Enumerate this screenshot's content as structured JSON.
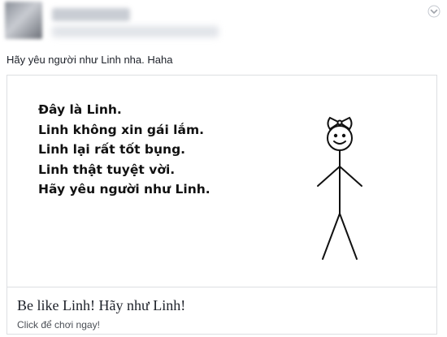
{
  "post": {
    "text": "Hãy yêu người như Linh nha. Haha"
  },
  "icons": {
    "options": "chevron-down-icon"
  },
  "card": {
    "image_lines": [
      "Đây là Linh.",
      "Linh không xin gái lắm.",
      "Linh lại rất tốt bụng.",
      "Linh thật tuyệt vời.",
      "Hãy yêu người như Linh."
    ],
    "title": "Be like Linh! Hãy như Linh!",
    "subtitle": "Click để chơi ngay!"
  },
  "colors": {
    "text": "#1d2129",
    "border": "#dddfe2",
    "muted": "#4b4f56"
  }
}
